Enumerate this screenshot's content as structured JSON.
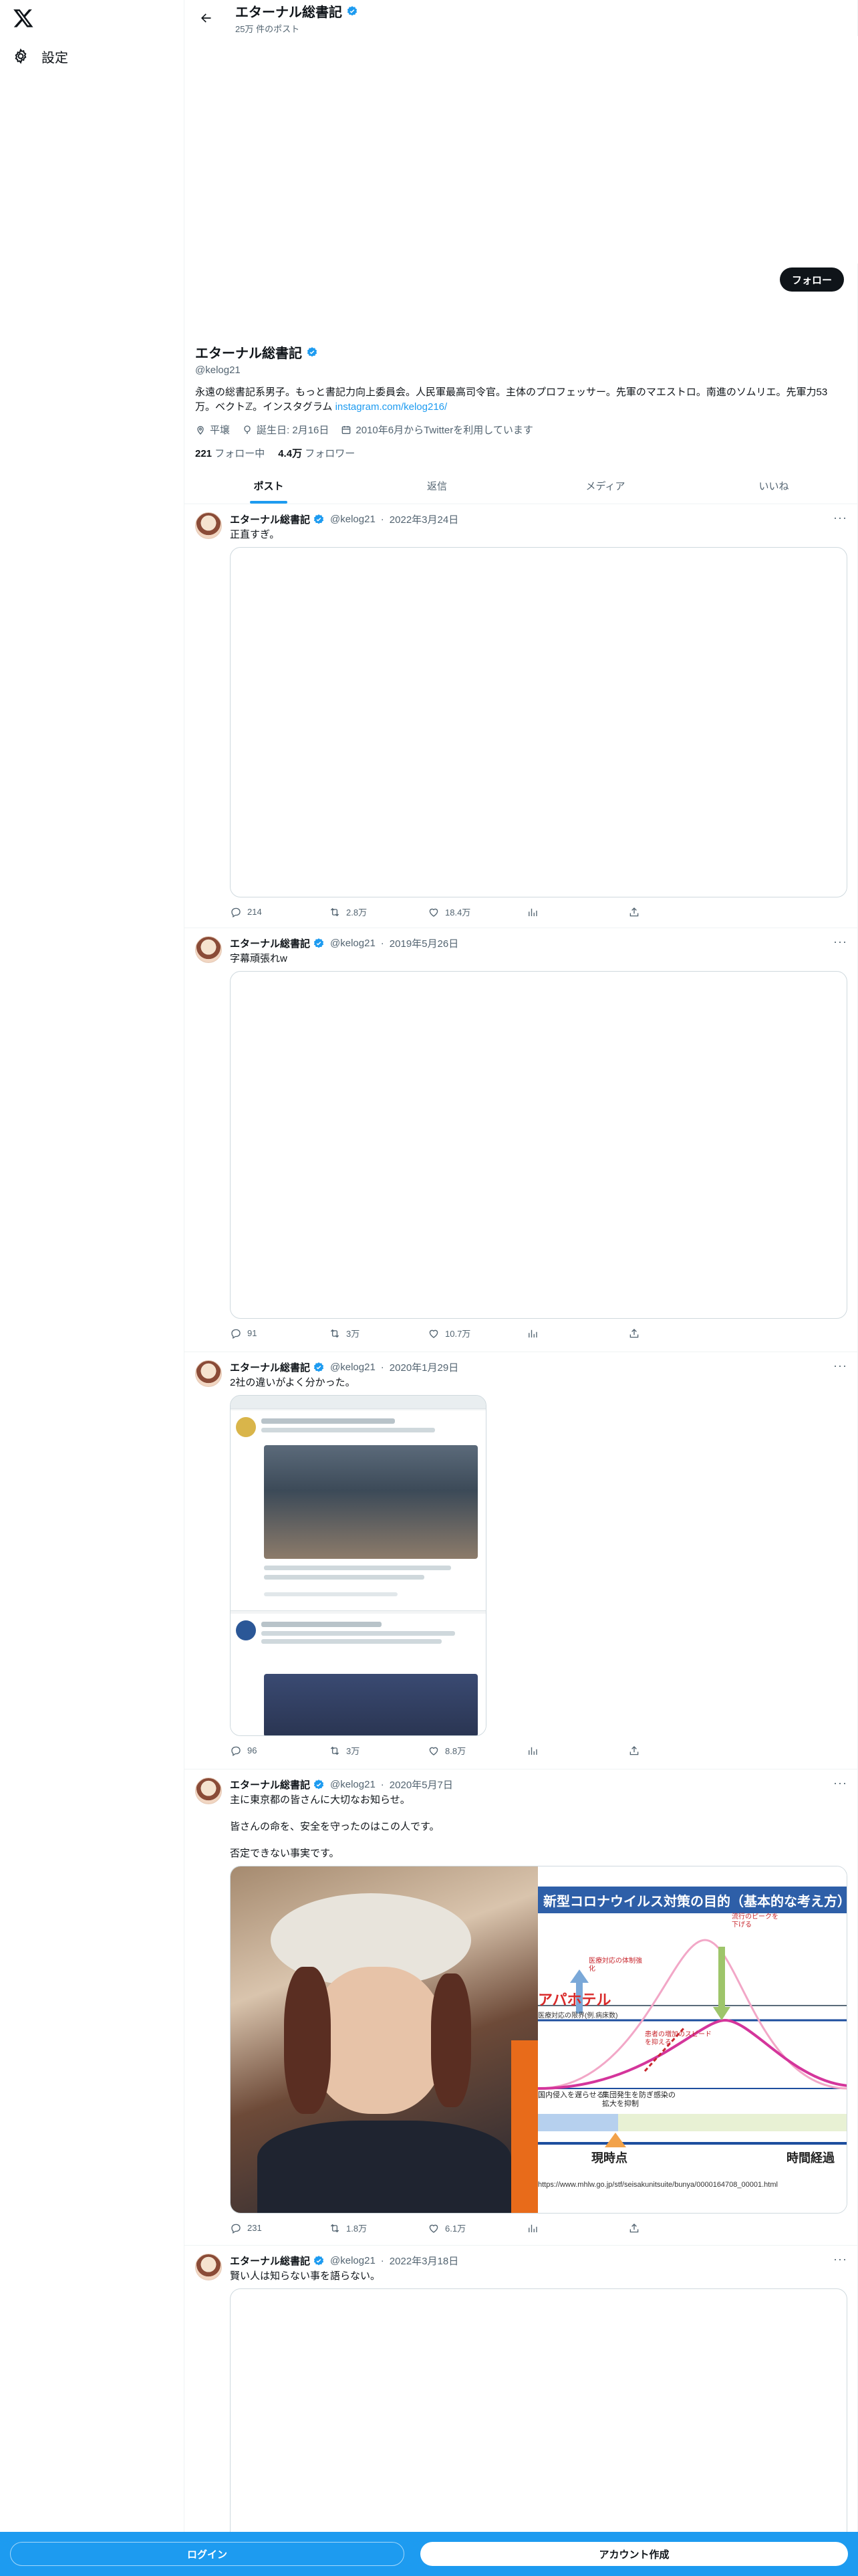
{
  "sidebar": {
    "settings_label": "設定"
  },
  "header": {
    "name": "エターナル総書記",
    "post_count": "25万 件のポスト"
  },
  "follow_label": "フォロー",
  "profile": {
    "name": "エターナル総書記",
    "handle": "@kelog21",
    "bio_text": "永遠の総書記系男子。もっと書記力向上委員会。人民軍最高司令官。主体のプロフェッサー。先軍のマエストロ。南進のソムリエ。先軍力53万。ベクトℤ。インスタグラム",
    "bio_link": "instagram.com/kelog216/",
    "location": "平壌",
    "birthday": "誕生日: 2月16日",
    "joined": "2010年6月からTwitterを利用しています",
    "following_count": "221",
    "following_label": "フォロー中",
    "followers_count": "4.4万",
    "followers_label": "フォロワー"
  },
  "tabs": [
    "ポスト",
    "返信",
    "メディア",
    "いいね"
  ],
  "tweets": [
    {
      "name": "エターナル総書記",
      "handle": "@kelog21",
      "date": "2022年3月24日",
      "text": "正直すぎ。",
      "replies": "214",
      "retweets": "2.8万",
      "likes": "18.4万"
    },
    {
      "name": "エターナル総書記",
      "handle": "@kelog21",
      "date": "2019年5月26日",
      "text": "字幕頑張れw",
      "replies": "91",
      "retweets": "3万",
      "likes": "10.7万"
    },
    {
      "name": "エターナル総書記",
      "handle": "@kelog21",
      "date": "2020年1月29日",
      "text": "2社の違いがよく分かった。",
      "replies": "96",
      "retweets": "3万",
      "likes": "8.8万"
    },
    {
      "name": "エターナル総書記",
      "handle": "@kelog21",
      "date": "2020年5月7日",
      "text": "主に東京都の皆さんに大切なお知らせ。\n\n皆さんの命を、安全を守ったのはこの人です。\n\n否定できない事実です。",
      "replies": "231",
      "retweets": "1.8万",
      "likes": "6.1万"
    },
    {
      "name": "エターナル総書記",
      "handle": "@kelog21",
      "date": "2022年3月18日",
      "text": "賢い人は知らない事を語らない。"
    }
  ],
  "media4": {
    "title": "新型コロナウイルス対策の目的（基本的な考え方）",
    "label_apa": "アパホテル",
    "label_peak": "流行のピークを下げる",
    "label_medical": "医療対応の体制強化",
    "label_limit": "医療対応の限界(例.病床数)",
    "label_delay": "患者の増加のスピードを抑える",
    "label_now": "現時点",
    "label_time": "時間経過",
    "label_a": "国内侵入を遅らせる",
    "label_b": "集団発生を防ぎ感染の拡大を抑制",
    "url": "https://www.mhlw.go.jp/stf/seisakunitsuite/bunya/0000164708_00001.html"
  },
  "bottom": {
    "login": "ログイン",
    "signup": "アカウント作成"
  },
  "colors": {
    "accent": "#1d9bf0",
    "text": "#0f1419",
    "muted": "#536471"
  }
}
